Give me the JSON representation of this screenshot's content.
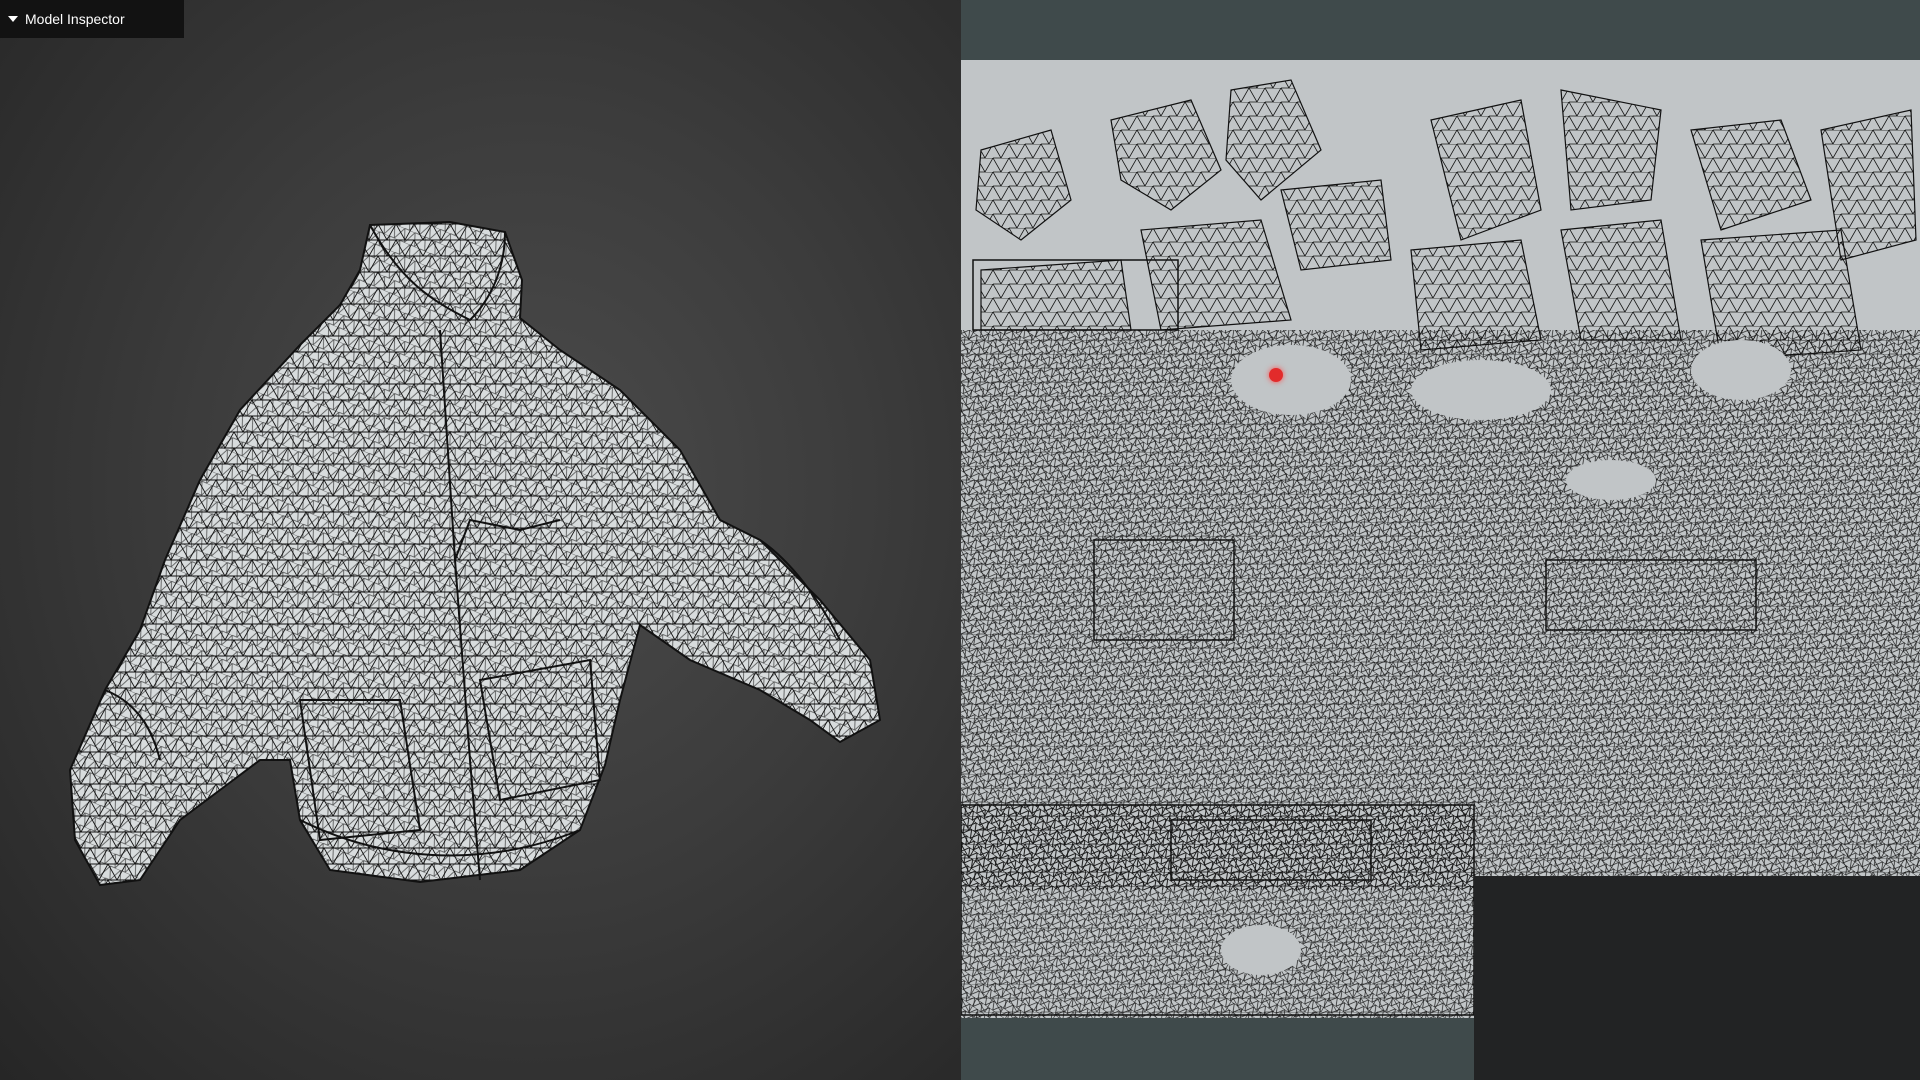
{
  "inspector": {
    "title": "Model Inspector",
    "toggle_icon": "caret-down-icon"
  },
  "colors": {
    "viewport_center": "#4b4b4b",
    "viewport_edge": "#262626",
    "uv_background": "#c1c5c7",
    "uv_panel": "#3f4a4b",
    "uv_empty_corner": "#222324",
    "marker": "#e22b2b",
    "wireframe": "#111111"
  }
}
